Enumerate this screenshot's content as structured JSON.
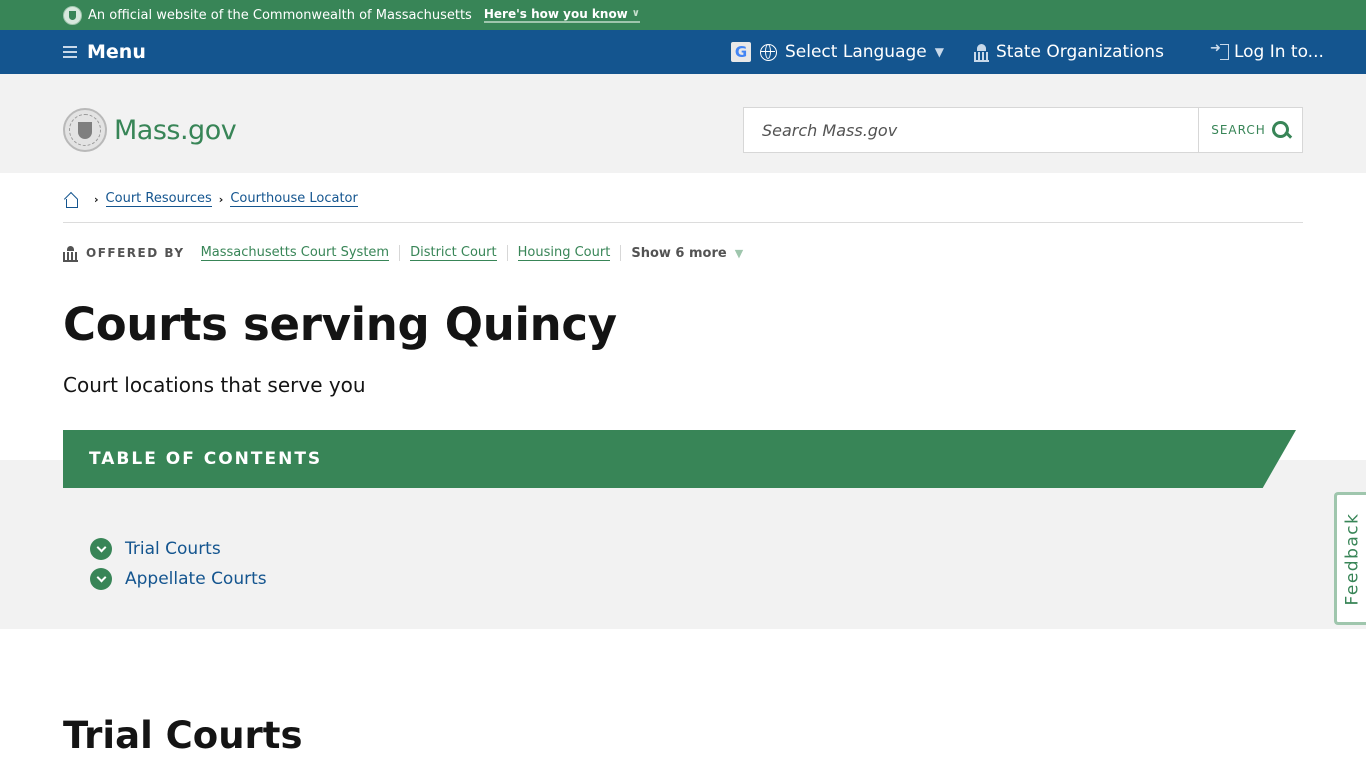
{
  "official_banner": {
    "text": "An official website of the Commonwealth of Massachusetts",
    "how_link": "Here's how you know"
  },
  "navbar": {
    "menu_label": "Menu",
    "google_icon_letter": "G",
    "language_label": "Select Language",
    "state_orgs_label": "State Organizations",
    "login_label": "Log In to..."
  },
  "header": {
    "logo_text": "Mass.gov",
    "search_placeholder": "Search Mass.gov",
    "search_button": "SEARCH"
  },
  "breadcrumb": {
    "items": [
      {
        "label": "Court Resources"
      },
      {
        "label": "Courthouse Locator"
      }
    ]
  },
  "offered_by": {
    "label": "OFFERED BY",
    "orgs": [
      {
        "label": "Massachusetts Court System"
      },
      {
        "label": "District Court"
      },
      {
        "label": "Housing Court"
      }
    ],
    "show_more": "Show 6 more"
  },
  "page": {
    "title": "Courts serving Quincy",
    "subtitle": "Court locations that serve you"
  },
  "toc": {
    "title": "TABLE OF CONTENTS",
    "items": [
      {
        "label": "Trial Courts"
      },
      {
        "label": "Appellate Courts"
      }
    ]
  },
  "feedback": {
    "label": "Feedback"
  },
  "section": {
    "title": "Trial Courts"
  },
  "colors": {
    "green": "#388557",
    "blue": "#14558f",
    "light_gray": "#f2f2f2",
    "text": "#141414"
  }
}
